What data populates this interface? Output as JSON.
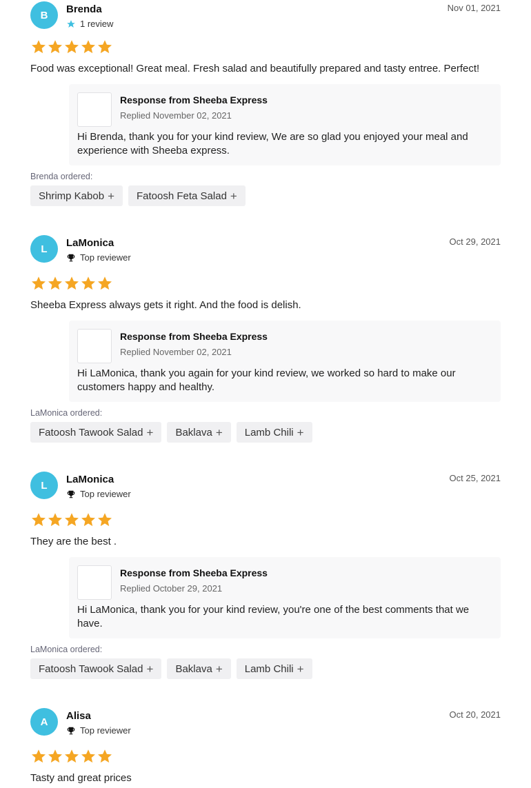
{
  "colors": {
    "avatar": "#3fbfe0",
    "star": "#f5a623",
    "response_bg": "#f8f8f9",
    "chip_bg": "#f0f0f2"
  },
  "reviews": [
    {
      "initial": "B",
      "name": "Brenda",
      "badge_icon": "star-icon",
      "badge": "1 review",
      "date": "Nov 01, 2021",
      "rating": 5,
      "text": "Food was exceptional! Great meal. Fresh salad and beautifully prepared and tasty entree. Perfect!",
      "response": {
        "title": "Response from Sheeba Express",
        "date": "Replied November 02, 2021",
        "body": "Hi Brenda, thank you for your kind review, We are so glad you enjoyed your meal and experience with Sheeba express."
      },
      "ordered_label": "Brenda ordered:",
      "items": [
        "Shrimp Kabob",
        "Fatoosh Feta Salad"
      ]
    },
    {
      "initial": "L",
      "name": "LaMonica",
      "badge_icon": "trophy-icon",
      "badge": "Top reviewer",
      "date": "Oct 29, 2021",
      "rating": 5,
      "text": "Sheeba Express always gets it right. And the food is delish.",
      "response": {
        "title": "Response from Sheeba Express",
        "date": "Replied November 02, 2021",
        "body": "Hi LaMonica, thank you again for your kind review, we worked so hard to make our customers happy and healthy."
      },
      "ordered_label": "LaMonica ordered:",
      "items": [
        "Fatoosh Tawook Salad",
        "Baklava",
        "Lamb Chili"
      ]
    },
    {
      "initial": "L",
      "name": "LaMonica",
      "badge_icon": "trophy-icon",
      "badge": "Top reviewer",
      "date": "Oct 25, 2021",
      "rating": 5,
      "text": "They are the best .",
      "response": {
        "title": "Response from Sheeba Express",
        "date": "Replied October 29, 2021",
        "body": "Hi LaMonica, thank you for your kind review, you're one of the best comments that we have."
      },
      "ordered_label": "LaMonica ordered:",
      "items": [
        "Fatoosh Tawook Salad",
        "Baklava",
        "Lamb Chili"
      ]
    },
    {
      "initial": "A",
      "name": "Alisa",
      "badge_icon": "trophy-icon",
      "badge": "Top reviewer",
      "date": "Oct 20, 2021",
      "rating": 5,
      "text": "Tasty and great prices"
    }
  ]
}
